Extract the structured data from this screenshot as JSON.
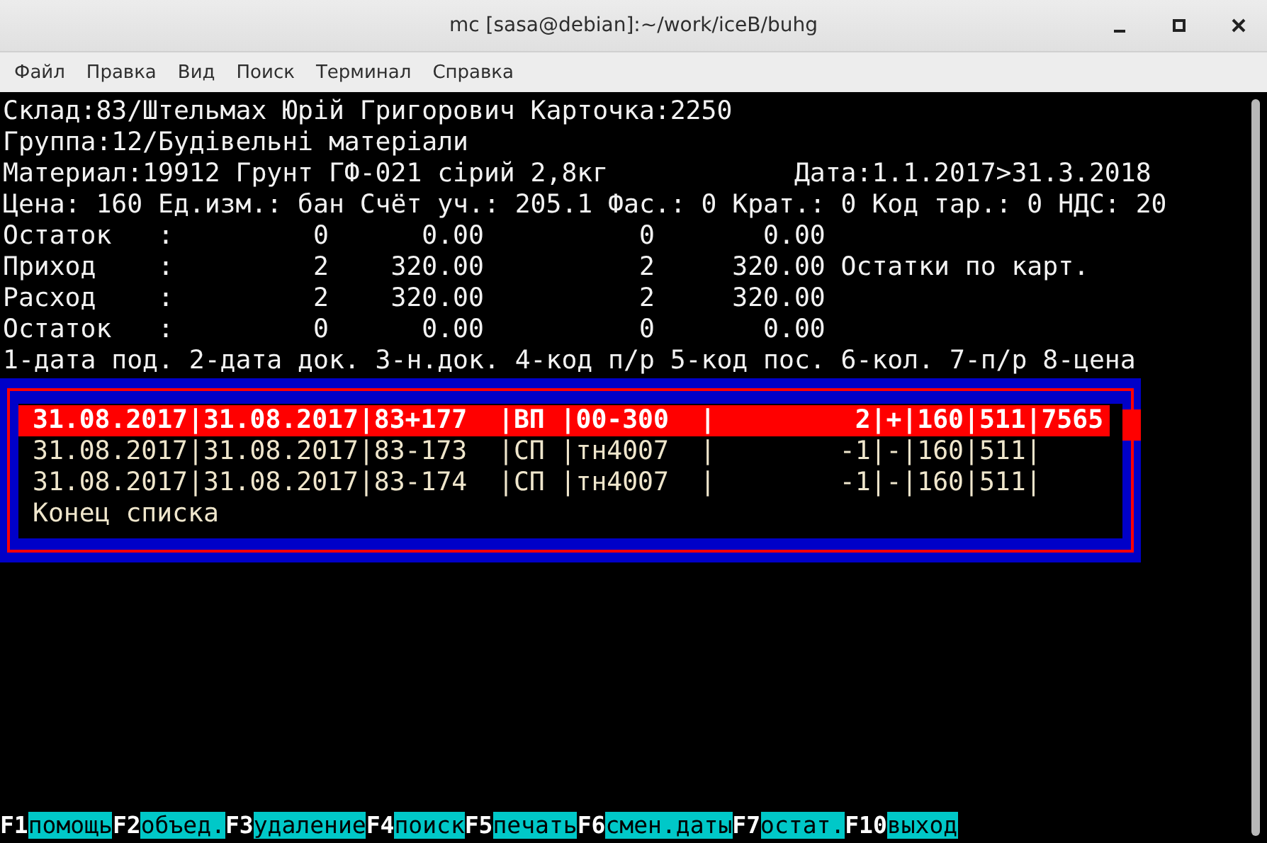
{
  "window": {
    "title": "mc [sasa@debian]:~/work/iceB/buhg"
  },
  "menu": [
    "Файл",
    "Правка",
    "Вид",
    "Поиск",
    "Терминал",
    "Справка"
  ],
  "header_lines": [
    "Склад:83/Штельмах Юрій Григорович Карточка:2250",
    "Группа:12/Будівельні матеріали",
    "Материал:19912 Грунт ГФ-021 сірий 2,8кг            Дата:1.1.2017>31.3.2018",
    "Цена: 160 Ед.изм.: бан Счёт уч.: 205.1 Фас.: 0 Крат.: 0 Код тар.: 0 НДС: 20",
    "Остаток   :         0      0.00          0       0.00",
    "Приход    :         2    320.00          2     320.00 Остатки по карт.",
    "Расход    :         2    320.00          2     320.00",
    "Остаток   :         0      0.00          0       0.00",
    "1-дата под. 2-дата док. 3-н.док. 4-код п/р 5-код пос. 6-кол. 7-п/р 8-цена"
  ],
  "list": {
    "rows": [
      {
        "text": "31.08.2017|31.08.2017|83+177  |ВП |00-300  |         2|+|160|511|7565",
        "selected": true
      },
      {
        "text": "31.08.2017|31.08.2017|83-173  |СП |тн4007  |        -1|-|160|511|",
        "selected": false
      },
      {
        "text": "31.08.2017|31.08.2017|83-174  |СП |тн4007  |        -1|-|160|511|",
        "selected": false
      }
    ],
    "end_label": "Конец списка"
  },
  "function_keys": [
    {
      "key": "F1",
      "label": "помощь"
    },
    {
      "key": "F2",
      "label": "объед."
    },
    {
      "key": "F3",
      "label": "удаление"
    },
    {
      "key": "F4",
      "label": "поиск"
    },
    {
      "key": "F5",
      "label": "печать"
    },
    {
      "key": "F6",
      "label": "смен.даты"
    },
    {
      "key": "F7",
      "label": "остат."
    },
    {
      "key": "F10",
      "label": "выход"
    }
  ]
}
